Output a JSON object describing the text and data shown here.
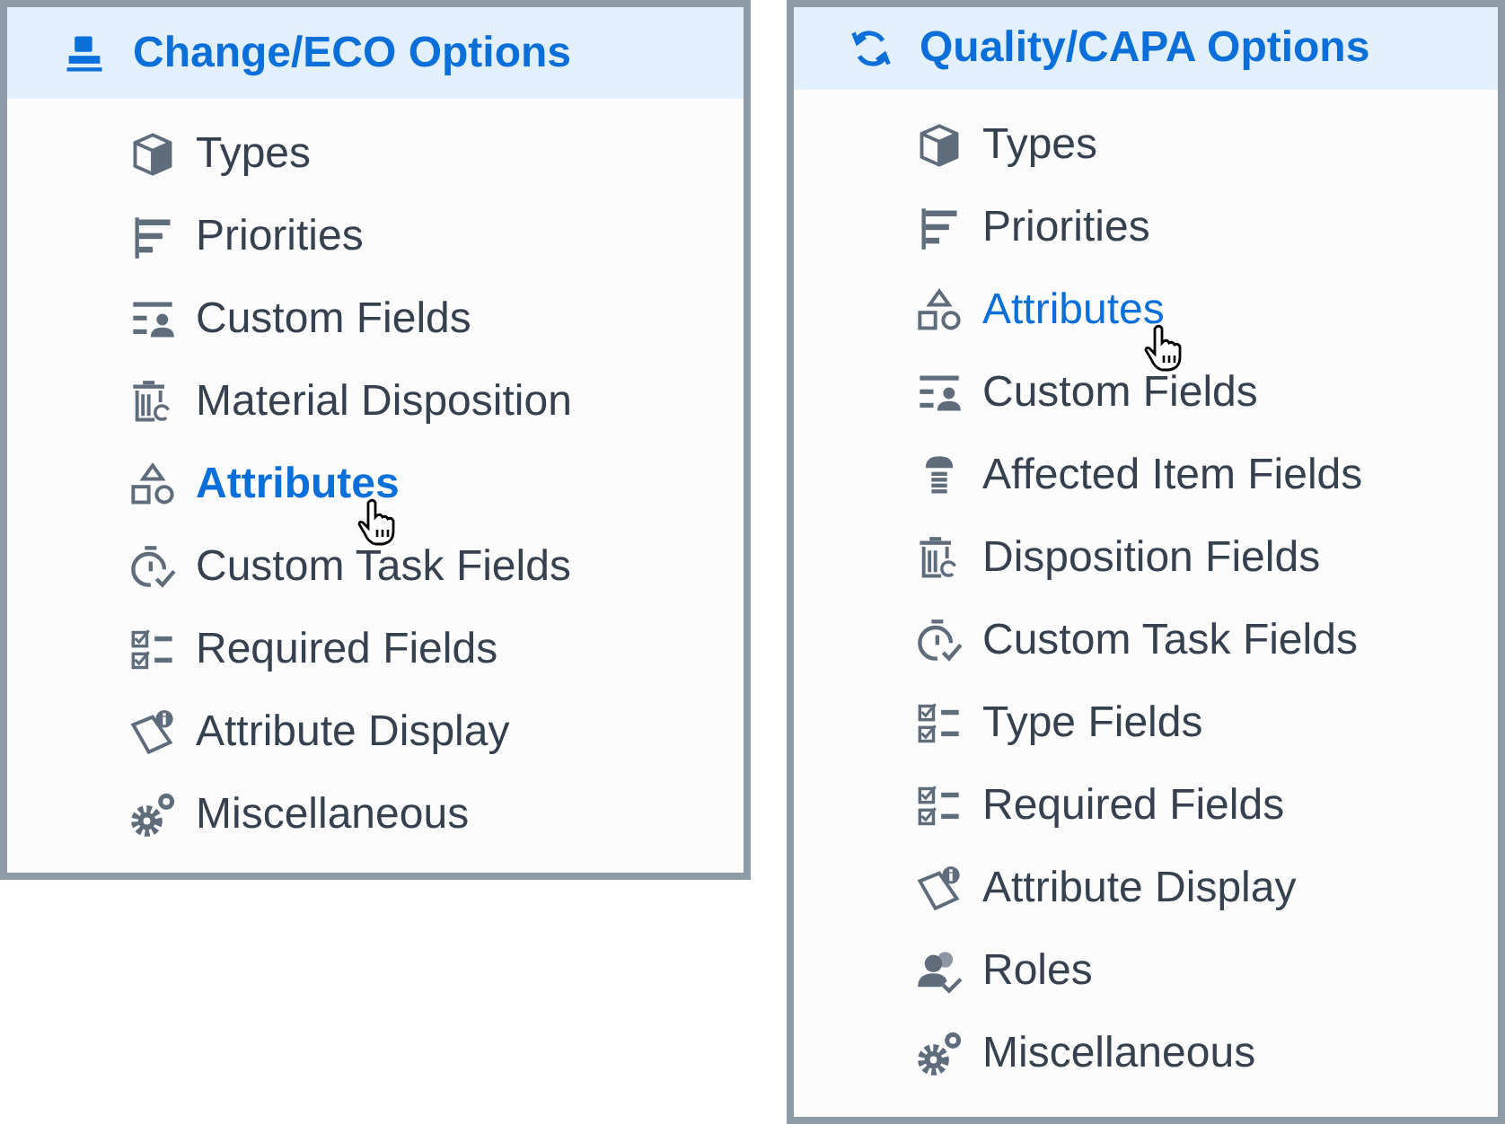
{
  "panels": [
    {
      "title": "Change/ECO Options",
      "kind": "stamp",
      "items": [
        {
          "label": "Types",
          "kind": "box",
          "selected": false,
          "hovered": false,
          "pointer": false
        },
        {
          "label": "Priorities",
          "kind": "priorities",
          "selected": false,
          "hovered": false,
          "pointer": false
        },
        {
          "label": "Custom Fields",
          "kind": "custom-fields",
          "selected": false,
          "hovered": false,
          "pointer": false
        },
        {
          "label": "Material Disposition",
          "kind": "disposition",
          "selected": false,
          "hovered": false,
          "pointer": false
        },
        {
          "label": "Attributes",
          "kind": "attributes",
          "selected": true,
          "hovered": true,
          "pointer": true
        },
        {
          "label": "Custom Task Fields",
          "kind": "timer",
          "selected": false,
          "hovered": false,
          "pointer": false
        },
        {
          "label": "Required Fields",
          "kind": "checklist",
          "selected": false,
          "hovered": false,
          "pointer": false
        },
        {
          "label": "Attribute Display",
          "kind": "attribute-display",
          "selected": false,
          "hovered": false,
          "pointer": false
        },
        {
          "label": "Miscellaneous",
          "kind": "gears",
          "selected": false,
          "hovered": false,
          "pointer": false
        }
      ]
    },
    {
      "title": "Quality/CAPA Options",
      "kind": "refresh",
      "items": [
        {
          "label": "Types",
          "kind": "box",
          "selected": false,
          "hovered": false,
          "pointer": false
        },
        {
          "label": "Priorities",
          "kind": "priorities",
          "selected": false,
          "hovered": false,
          "pointer": false
        },
        {
          "label": "Attributes",
          "kind": "attributes",
          "selected": false,
          "hovered": true,
          "pointer": true
        },
        {
          "label": "Custom Fields",
          "kind": "custom-fields",
          "selected": false,
          "hovered": false,
          "pointer": false
        },
        {
          "label": "Affected Item Fields",
          "kind": "screw",
          "selected": false,
          "hovered": false,
          "pointer": false
        },
        {
          "label": "Disposition Fields",
          "kind": "disposition",
          "selected": false,
          "hovered": false,
          "pointer": false
        },
        {
          "label": "Custom Task Fields",
          "kind": "timer",
          "selected": false,
          "hovered": false,
          "pointer": false
        },
        {
          "label": "Type Fields",
          "kind": "checklist",
          "selected": false,
          "hovered": false,
          "pointer": false
        },
        {
          "label": "Required Fields",
          "kind": "checklist",
          "selected": false,
          "hovered": false,
          "pointer": false
        },
        {
          "label": "Attribute Display",
          "kind": "attribute-display",
          "selected": false,
          "hovered": false,
          "pointer": false
        },
        {
          "label": "Roles",
          "kind": "roles",
          "selected": false,
          "hovered": false,
          "pointer": false
        },
        {
          "label": "Miscellaneous",
          "kind": "gears",
          "selected": false,
          "hovered": false,
          "pointer": false
        }
      ]
    }
  ]
}
